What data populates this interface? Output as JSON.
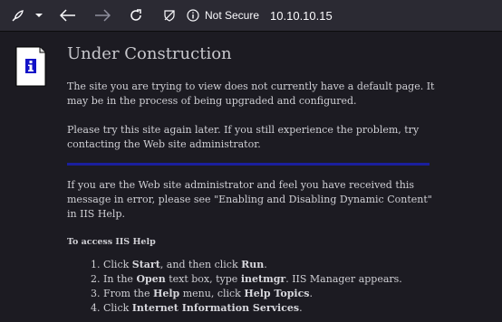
{
  "browser": {
    "toolbar_icons": [
      "extension-icon",
      "chevron-down-icon",
      "back-icon",
      "forward-icon",
      "reload-icon"
    ],
    "security_label": "Not Secure",
    "url": "10.10.10.15"
  },
  "page": {
    "title": "Under Construction",
    "para1": "The site you are trying to view does not currently have a default page. It may be in the process of being upgraded and configured.",
    "para2": "Please try this site again later. If you still experience the problem, try contacting the Web site administrator.",
    "para3": "If you are the Web site administrator and feel you have received this message in error, please see \"Enabling and Disabling Dynamic Content\" in IIS Help.",
    "help_heading": "To access IIS Help",
    "steps": [
      {
        "a": "Click ",
        "b1": "Start",
        "c": ", and then click ",
        "b2": "Run",
        "d": "."
      },
      {
        "a": "In the ",
        "b1": "Open",
        "c": " text box, type ",
        "b2": "inetmgr",
        "d": ". IIS Manager appears."
      },
      {
        "a": "From the ",
        "b1": "Help",
        "c": " menu, click ",
        "b2": "Help Topics",
        "d": "."
      },
      {
        "a": "Click ",
        "b1": "Internet Information Services",
        "c": ".",
        "b2": "",
        "d": ""
      }
    ],
    "rule_color": "#1a1f9e"
  }
}
